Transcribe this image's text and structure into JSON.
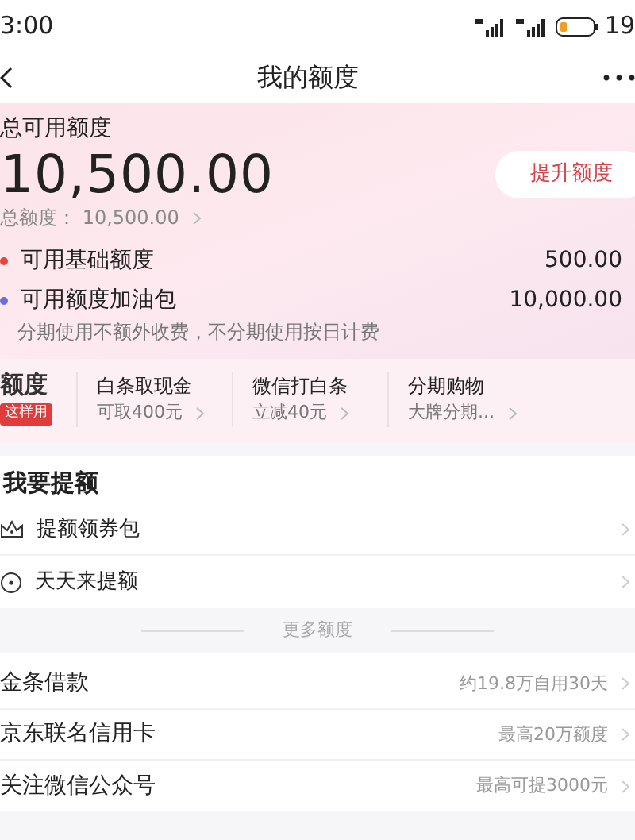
{
  "status_bar": {
    "time": "3:00",
    "battery": "19"
  },
  "nav": {
    "title": "我的额度"
  },
  "header": {
    "label": "总可用额度",
    "amount": "10,500.00",
    "button": "提升额度",
    "total": "总额度： 10,500.00"
  },
  "quotas": [
    {
      "label": "可用基础额度",
      "amount": "500.00",
      "color": "#e8453c"
    },
    {
      "label": "可用额度加油包",
      "amount": "10,000.00",
      "color": "#6a6fd8"
    }
  ],
  "quota_note": "分期使用不额外收费，不分期使用按日计费",
  "usage": {
    "title": "额度",
    "badge": "这样用",
    "items": [
      {
        "title": "白条取现金",
        "sub": "可取400元"
      },
      {
        "title": "微信打白条",
        "sub": "立减40元"
      },
      {
        "title": "分期购物",
        "sub": "大牌分期..."
      }
    ]
  },
  "raise": {
    "title": "我要提额",
    "items": [
      {
        "kind": "crown",
        "label": "提额领券包"
      },
      {
        "kind": "target",
        "label": "天天来提额"
      }
    ]
  },
  "more_divider": "更多额度",
  "more": [
    {
      "title": "金条借款",
      "desc": "约19.8万自用30天"
    },
    {
      "title": "京东联名信用卡",
      "desc": "最高20万额度"
    },
    {
      "title": "关注微信公众号",
      "desc": "最高可提3000元"
    }
  ]
}
